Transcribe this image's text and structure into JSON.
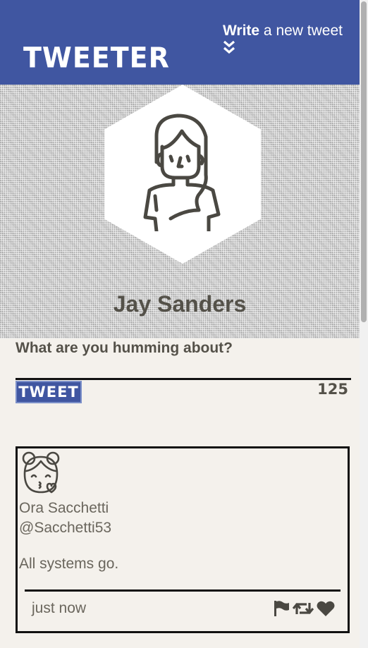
{
  "nav": {
    "brand": "TWEETER",
    "compose_strong": "Write",
    "compose_rest": " a new tweet"
  },
  "profile": {
    "name": "Jay Sanders"
  },
  "composer": {
    "label": "What are you humming about?",
    "input_value": "",
    "button_label": "TWEET",
    "char_count": "125"
  },
  "tweets": [
    {
      "name": "Ora Sacchetti",
      "handle": "@Sacchetti53",
      "text": "All systems go.",
      "time": "just now",
      "actions": [
        "flag-icon",
        "retweet-icon",
        "heart-icon"
      ]
    }
  ],
  "colors": {
    "nav_bg": "#4056a1",
    "page_bg": "#f4f1ec",
    "text": "#545149"
  }
}
